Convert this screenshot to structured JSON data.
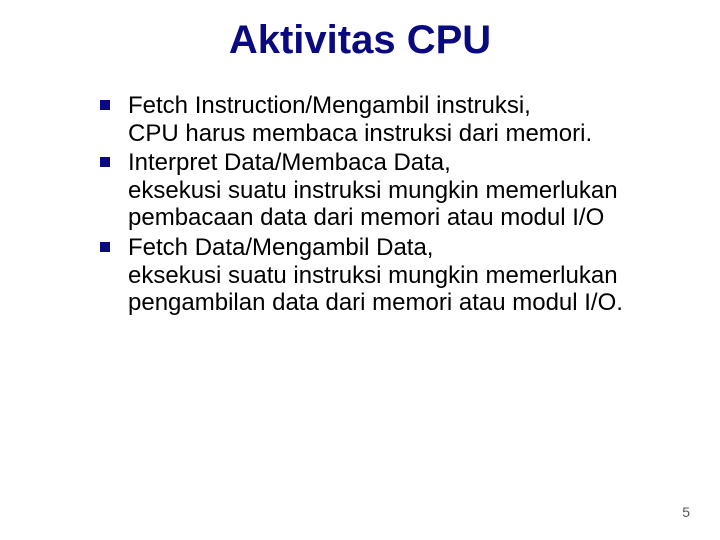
{
  "title": "Aktivitas CPU",
  "items": [
    {
      "heading": "Fetch Instruction/Mengambil instruksi,",
      "desc": "CPU harus membaca instruksi dari memori."
    },
    {
      "heading": "Interpret Data/Membaca Data,",
      "desc": "eksekusi suatu instruksi mungkin memerlukan pembacaan data dari memori atau modul I/O"
    },
    {
      "heading": "Fetch Data/Mengambil Data,",
      "desc": "eksekusi suatu instruksi mungkin memerlukan pengambilan data dari memori atau modul I/O."
    }
  ],
  "page_number": "5"
}
